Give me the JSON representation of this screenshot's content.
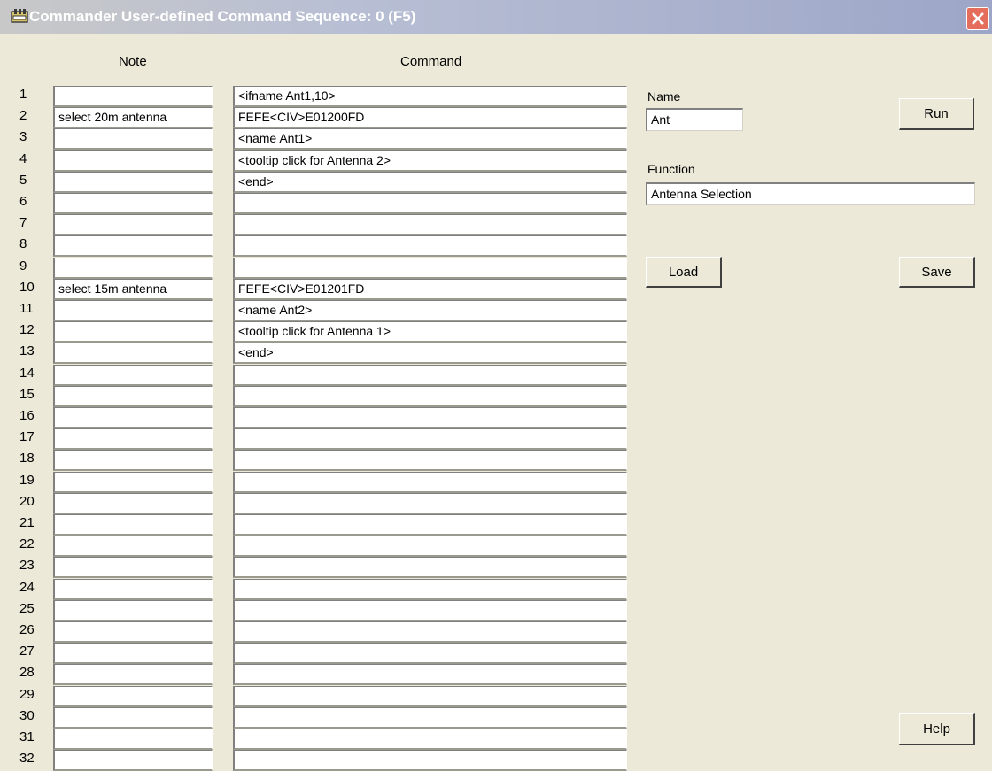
{
  "window": {
    "title": "Commander User-defined Command Sequence: 0 (F5)",
    "app_icon": "commander-app-icon",
    "close_icon": "close-icon"
  },
  "table": {
    "note_header": "Note",
    "command_header": "Command",
    "rows": [
      {
        "num": "1",
        "note": "",
        "command": "<ifname Ant1,10>"
      },
      {
        "num": "2",
        "note": "select 20m antenna",
        "command": "FEFE<CIV>E01200FD"
      },
      {
        "num": "3",
        "note": "",
        "command": "<name Ant1>"
      },
      {
        "num": "4",
        "note": "",
        "command": "<tooltip click for Antenna 2>"
      },
      {
        "num": "5",
        "note": "",
        "command": "<end>"
      },
      {
        "num": "6",
        "note": "",
        "command": ""
      },
      {
        "num": "7",
        "note": "",
        "command": ""
      },
      {
        "num": "8",
        "note": "",
        "command": ""
      },
      {
        "num": "9",
        "note": "",
        "command": ""
      },
      {
        "num": "10",
        "note": "select 15m antenna",
        "command": "FEFE<CIV>E01201FD"
      },
      {
        "num": "11",
        "note": "",
        "command": "<name Ant2>"
      },
      {
        "num": "12",
        "note": "",
        "command": "<tooltip click for Antenna 1>"
      },
      {
        "num": "13",
        "note": "",
        "command": "<end>"
      },
      {
        "num": "14",
        "note": "",
        "command": ""
      },
      {
        "num": "15",
        "note": "",
        "command": ""
      },
      {
        "num": "16",
        "note": "",
        "command": ""
      },
      {
        "num": "17",
        "note": "",
        "command": ""
      },
      {
        "num": "18",
        "note": "",
        "command": ""
      },
      {
        "num": "19",
        "note": "",
        "command": ""
      },
      {
        "num": "20",
        "note": "",
        "command": ""
      },
      {
        "num": "21",
        "note": "",
        "command": ""
      },
      {
        "num": "22",
        "note": "",
        "command": ""
      },
      {
        "num": "23",
        "note": "",
        "command": ""
      },
      {
        "num": "24",
        "note": "",
        "command": ""
      },
      {
        "num": "25",
        "note": "",
        "command": ""
      },
      {
        "num": "26",
        "note": "",
        "command": ""
      },
      {
        "num": "27",
        "note": "",
        "command": ""
      },
      {
        "num": "28",
        "note": "",
        "command": ""
      },
      {
        "num": "29",
        "note": "",
        "command": ""
      },
      {
        "num": "30",
        "note": "",
        "command": ""
      },
      {
        "num": "31",
        "note": "",
        "command": ""
      },
      {
        "num": "32",
        "note": "",
        "command": ""
      }
    ]
  },
  "panel": {
    "name_label": "Name",
    "name_value": "Ant",
    "function_label": "Function",
    "function_value": "Antenna Selection",
    "run_label": "Run",
    "load_label": "Load",
    "save_label": "Save",
    "help_label": "Help"
  },
  "colors": {
    "window_bg": "#ece9d8",
    "title_gradient_start": "#c8c8c8",
    "title_gradient_end": "#9da6c8",
    "close_button": "#e46d5c"
  }
}
